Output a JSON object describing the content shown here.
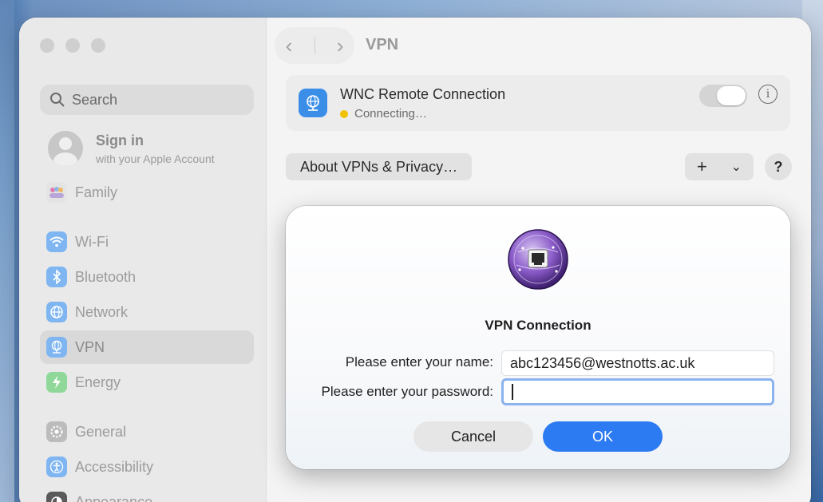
{
  "sidebar": {
    "search_placeholder": "Search",
    "signin": {
      "title": "Sign in",
      "subtitle": "with your Apple Account"
    },
    "items": [
      {
        "label": "Family",
        "icon": "family-icon"
      },
      {
        "label": "Wi-Fi",
        "icon": "wifi-icon"
      },
      {
        "label": "Bluetooth",
        "icon": "bluetooth-icon"
      },
      {
        "label": "Network",
        "icon": "network-icon"
      },
      {
        "label": "VPN",
        "icon": "vpn-icon",
        "selected": true
      },
      {
        "label": "Energy",
        "icon": "energy-icon"
      },
      {
        "label": "General",
        "icon": "gear-icon"
      },
      {
        "label": "Accessibility",
        "icon": "accessibility-icon"
      },
      {
        "label": "Appearance",
        "icon": "appearance-icon"
      }
    ]
  },
  "header": {
    "title": "VPN",
    "back": "‹",
    "forward": "›"
  },
  "vpn": {
    "name": "WNC Remote Connection",
    "status": "Connecting…",
    "status_color": "#f2c200",
    "info": "i"
  },
  "toolbar": {
    "about_label": "About VPNs & Privacy…",
    "add_label": "+",
    "menu_label": "⌄",
    "help_label": "?"
  },
  "dialog": {
    "title": "VPN Connection",
    "name_label": "Please enter your name:",
    "name_value": "abc123456@westnotts.ac.uk",
    "password_label": "Please enter your password:",
    "password_value": "",
    "cancel_label": "Cancel",
    "ok_label": "OK",
    "accent": "#2d7bf2"
  }
}
